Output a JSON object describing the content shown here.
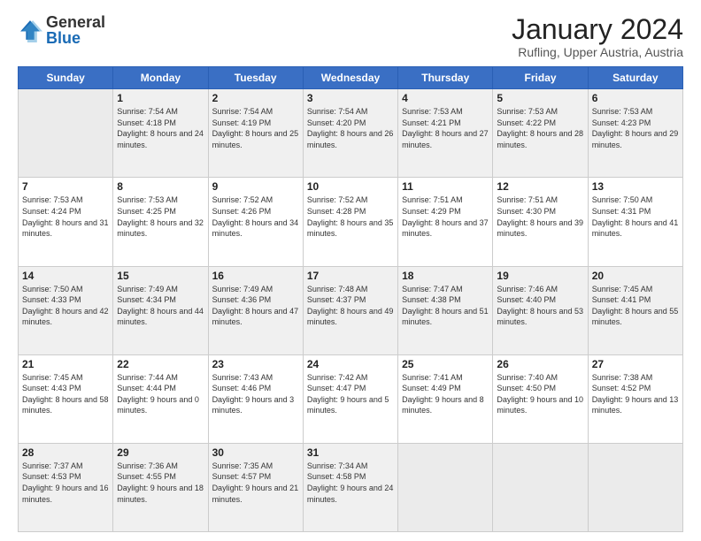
{
  "logo": {
    "general": "General",
    "blue": "Blue"
  },
  "title": "January 2024",
  "location": "Rufling, Upper Austria, Austria",
  "weekdays": [
    "Sunday",
    "Monday",
    "Tuesday",
    "Wednesday",
    "Thursday",
    "Friday",
    "Saturday"
  ],
  "weeks": [
    [
      {
        "day": "",
        "empty": true
      },
      {
        "day": "1",
        "sunrise": "7:54 AM",
        "sunset": "4:18 PM",
        "daylight": "8 hours and 24 minutes."
      },
      {
        "day": "2",
        "sunrise": "7:54 AM",
        "sunset": "4:19 PM",
        "daylight": "8 hours and 25 minutes."
      },
      {
        "day": "3",
        "sunrise": "7:54 AM",
        "sunset": "4:20 PM",
        "daylight": "8 hours and 26 minutes."
      },
      {
        "day": "4",
        "sunrise": "7:53 AM",
        "sunset": "4:21 PM",
        "daylight": "8 hours and 27 minutes."
      },
      {
        "day": "5",
        "sunrise": "7:53 AM",
        "sunset": "4:22 PM",
        "daylight": "8 hours and 28 minutes."
      },
      {
        "day": "6",
        "sunrise": "7:53 AM",
        "sunset": "4:23 PM",
        "daylight": "8 hours and 29 minutes."
      }
    ],
    [
      {
        "day": "7",
        "sunrise": "7:53 AM",
        "sunset": "4:24 PM",
        "daylight": "8 hours and 31 minutes."
      },
      {
        "day": "8",
        "sunrise": "7:53 AM",
        "sunset": "4:25 PM",
        "daylight": "8 hours and 32 minutes."
      },
      {
        "day": "9",
        "sunrise": "7:52 AM",
        "sunset": "4:26 PM",
        "daylight": "8 hours and 34 minutes."
      },
      {
        "day": "10",
        "sunrise": "7:52 AM",
        "sunset": "4:28 PM",
        "daylight": "8 hours and 35 minutes."
      },
      {
        "day": "11",
        "sunrise": "7:51 AM",
        "sunset": "4:29 PM",
        "daylight": "8 hours and 37 minutes."
      },
      {
        "day": "12",
        "sunrise": "7:51 AM",
        "sunset": "4:30 PM",
        "daylight": "8 hours and 39 minutes."
      },
      {
        "day": "13",
        "sunrise": "7:50 AM",
        "sunset": "4:31 PM",
        "daylight": "8 hours and 41 minutes."
      }
    ],
    [
      {
        "day": "14",
        "sunrise": "7:50 AM",
        "sunset": "4:33 PM",
        "daylight": "8 hours and 42 minutes."
      },
      {
        "day": "15",
        "sunrise": "7:49 AM",
        "sunset": "4:34 PM",
        "daylight": "8 hours and 44 minutes."
      },
      {
        "day": "16",
        "sunrise": "7:49 AM",
        "sunset": "4:36 PM",
        "daylight": "8 hours and 47 minutes."
      },
      {
        "day": "17",
        "sunrise": "7:48 AM",
        "sunset": "4:37 PM",
        "daylight": "8 hours and 49 minutes."
      },
      {
        "day": "18",
        "sunrise": "7:47 AM",
        "sunset": "4:38 PM",
        "daylight": "8 hours and 51 minutes."
      },
      {
        "day": "19",
        "sunrise": "7:46 AM",
        "sunset": "4:40 PM",
        "daylight": "8 hours and 53 minutes."
      },
      {
        "day": "20",
        "sunrise": "7:45 AM",
        "sunset": "4:41 PM",
        "daylight": "8 hours and 55 minutes."
      }
    ],
    [
      {
        "day": "21",
        "sunrise": "7:45 AM",
        "sunset": "4:43 PM",
        "daylight": "8 hours and 58 minutes."
      },
      {
        "day": "22",
        "sunrise": "7:44 AM",
        "sunset": "4:44 PM",
        "daylight": "9 hours and 0 minutes."
      },
      {
        "day": "23",
        "sunrise": "7:43 AM",
        "sunset": "4:46 PM",
        "daylight": "9 hours and 3 minutes."
      },
      {
        "day": "24",
        "sunrise": "7:42 AM",
        "sunset": "4:47 PM",
        "daylight": "9 hours and 5 minutes."
      },
      {
        "day": "25",
        "sunrise": "7:41 AM",
        "sunset": "4:49 PM",
        "daylight": "9 hours and 8 minutes."
      },
      {
        "day": "26",
        "sunrise": "7:40 AM",
        "sunset": "4:50 PM",
        "daylight": "9 hours and 10 minutes."
      },
      {
        "day": "27",
        "sunrise": "7:38 AM",
        "sunset": "4:52 PM",
        "daylight": "9 hours and 13 minutes."
      }
    ],
    [
      {
        "day": "28",
        "sunrise": "7:37 AM",
        "sunset": "4:53 PM",
        "daylight": "9 hours and 16 minutes."
      },
      {
        "day": "29",
        "sunrise": "7:36 AM",
        "sunset": "4:55 PM",
        "daylight": "9 hours and 18 minutes."
      },
      {
        "day": "30",
        "sunrise": "7:35 AM",
        "sunset": "4:57 PM",
        "daylight": "9 hours and 21 minutes."
      },
      {
        "day": "31",
        "sunrise": "7:34 AM",
        "sunset": "4:58 PM",
        "daylight": "9 hours and 24 minutes."
      },
      {
        "day": "",
        "empty": true
      },
      {
        "day": "",
        "empty": true
      },
      {
        "day": "",
        "empty": true
      }
    ]
  ]
}
